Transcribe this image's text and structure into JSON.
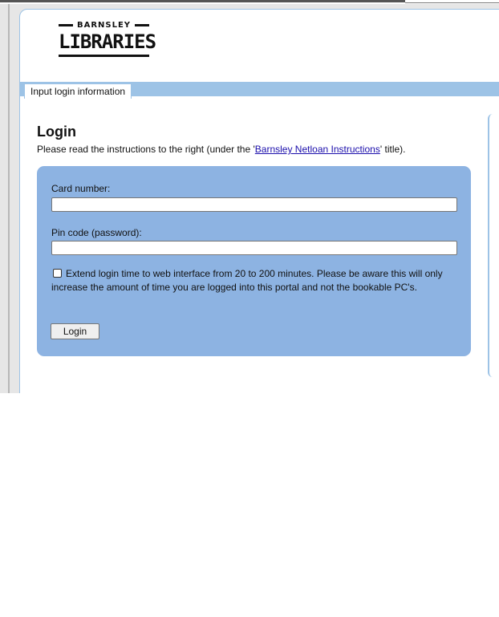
{
  "logo": {
    "small_text": "BARNSLEY",
    "main_text": "LIBRARIES"
  },
  "tabs": [
    {
      "label": "Input login information"
    }
  ],
  "login": {
    "title": "Login",
    "instructions_prefix": "Please read the instructions to the right (under the '",
    "instructions_link": "Barnsley Netloan Instructions",
    "instructions_suffix": "' title).",
    "card_label": "Card number:",
    "card_value": "",
    "pin_label": "Pin code (password):",
    "pin_value": "",
    "extend_checked": false,
    "extend_label": "Extend login time to web interface from 20 to 200 minutes. Please be aware this will only increase the amount of time you are logged into this portal and not the bookable PC's.",
    "button_label": "Login"
  }
}
